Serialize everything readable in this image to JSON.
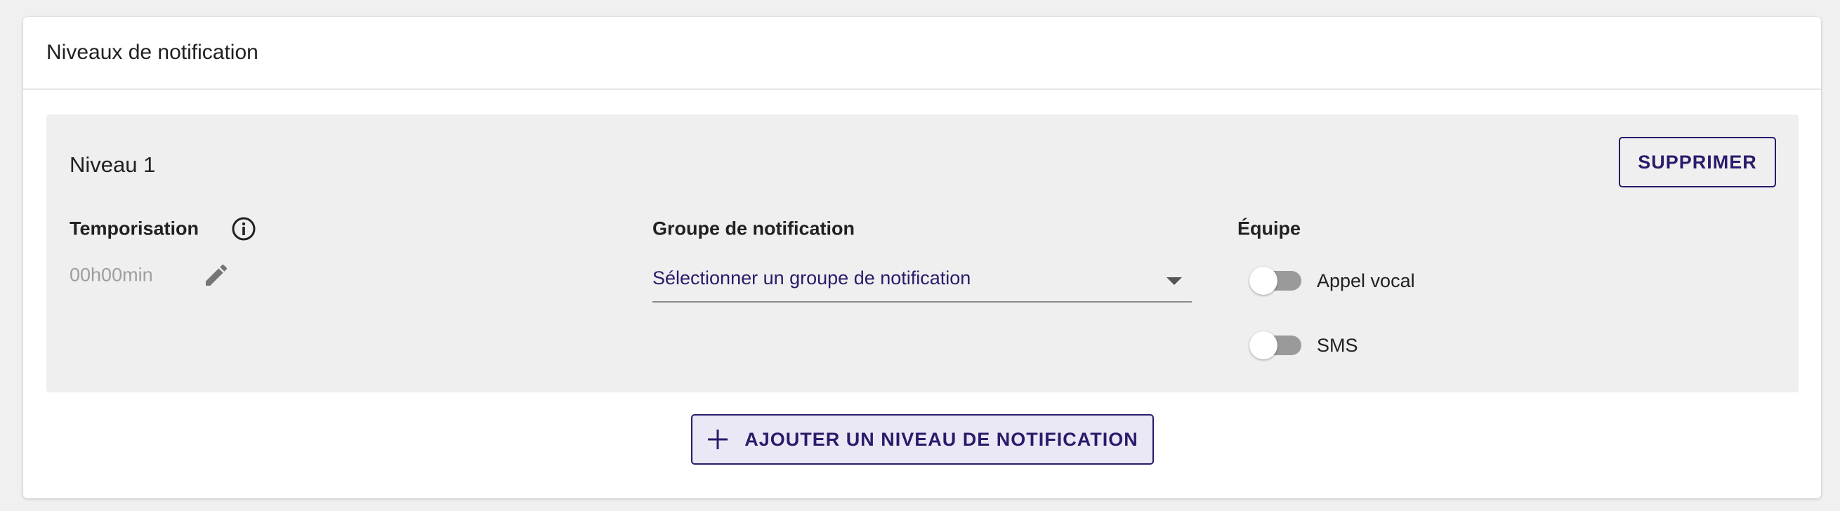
{
  "card": {
    "title": "Niveaux de notification"
  },
  "level": {
    "title": "Niveau 1",
    "delete_label": "SUPPRIMER",
    "temporisation": {
      "label": "Temporisation",
      "value": "00h00min"
    },
    "groupe": {
      "label": "Groupe de notification",
      "placeholder": "Sélectionner un groupe de notification"
    },
    "equipe": {
      "label": "Équipe",
      "toggles": [
        {
          "label": "Appel vocal",
          "checked": false
        },
        {
          "label": "SMS",
          "checked": false
        }
      ]
    }
  },
  "add_button": {
    "label": "AJOUTER UN NIVEAU DE NOTIFICATION"
  },
  "colors": {
    "accent": "#2c1a6b",
    "panel": "#efefef",
    "page_bg": "#f0f0f0",
    "toggle_off": "#9a9a9a"
  },
  "icons": [
    "info-icon",
    "edit-icon",
    "chevron-down-icon",
    "plus-icon"
  ]
}
